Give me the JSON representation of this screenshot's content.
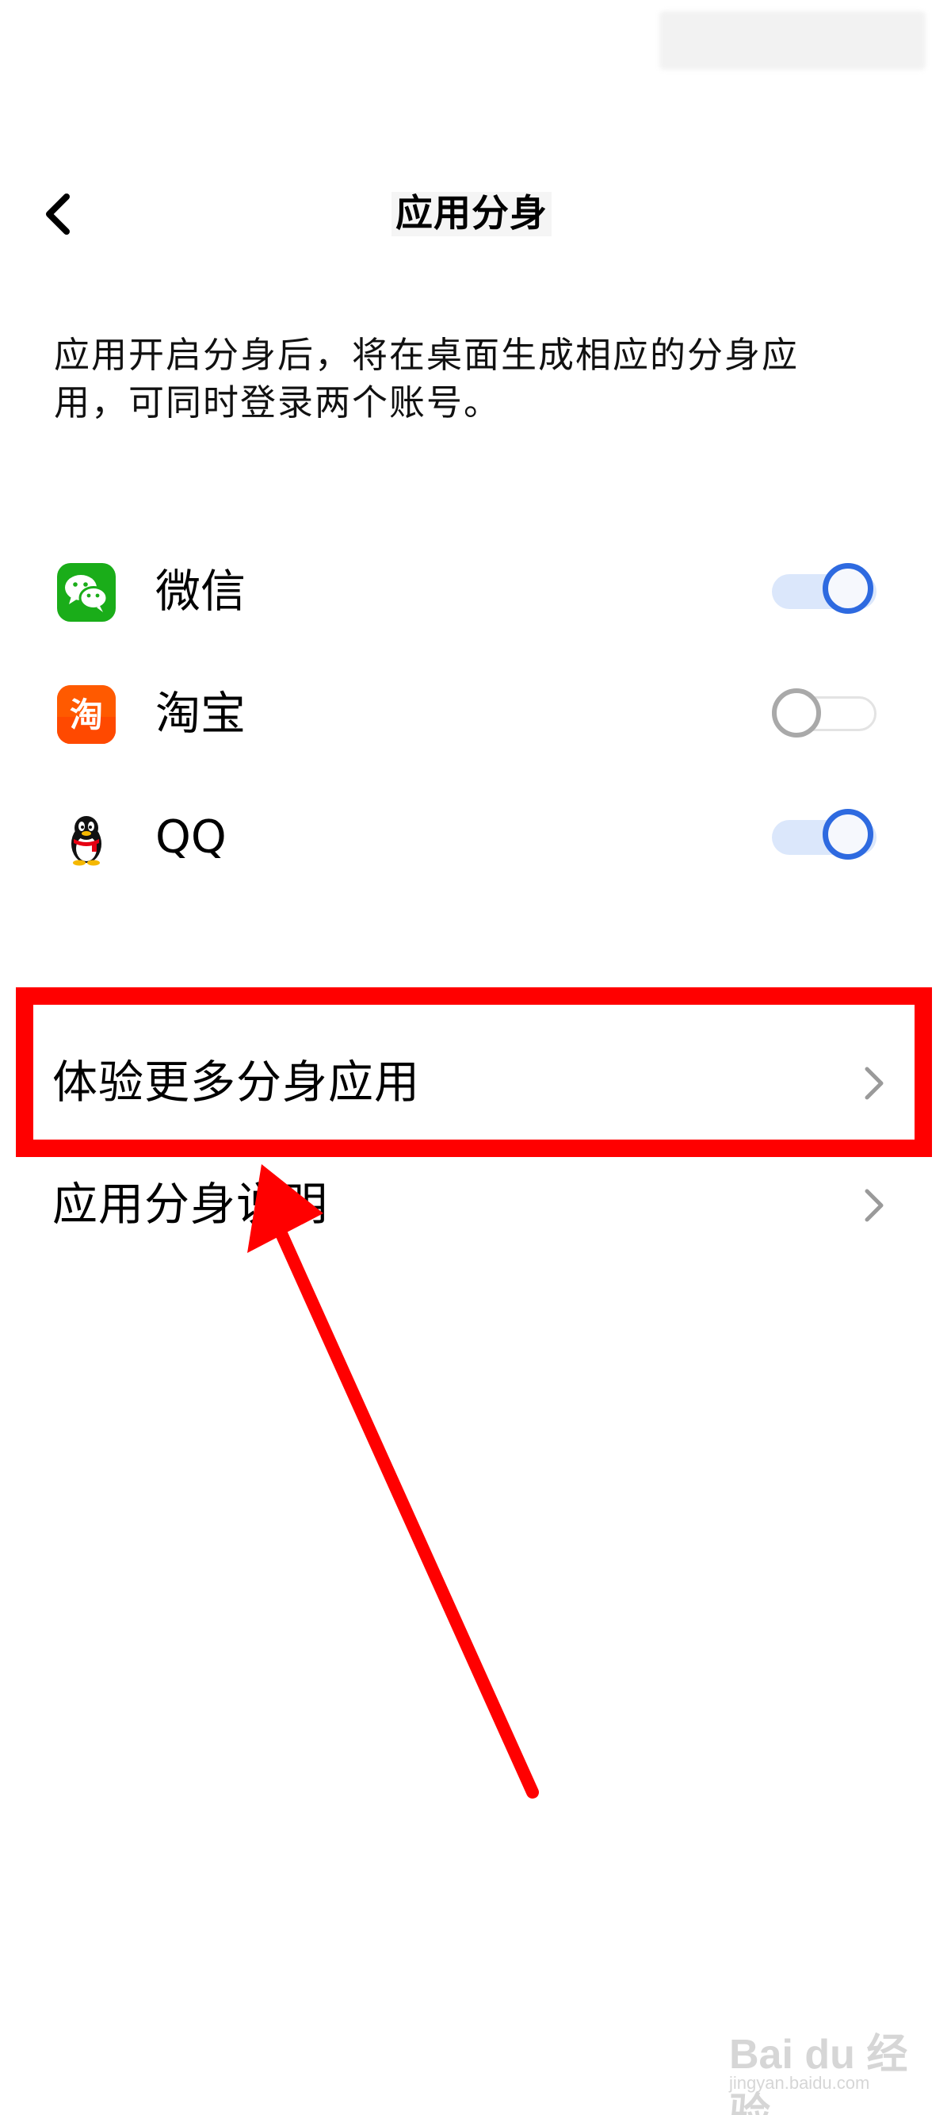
{
  "header": {
    "title": "应用分身",
    "back_icon": "chevron-left-icon"
  },
  "description": "应用开启分身后，将在桌面生成相应的分身应用，可同时登录两个账号。",
  "apps": [
    {
      "name": "微信",
      "icon": "wechat-icon",
      "icon_color": "#1aad19",
      "enabled": true
    },
    {
      "name": "淘宝",
      "icon": "taobao-icon",
      "icon_color": "#ff5000",
      "icon_text": "淘",
      "enabled": false
    },
    {
      "name": "QQ",
      "icon": "qq-penguin-icon",
      "enabled": true
    }
  ],
  "links": [
    {
      "label": "体验更多分身应用",
      "icon": "chevron-right-icon"
    },
    {
      "label": "应用分身说明",
      "icon": "chevron-right-icon"
    }
  ],
  "annotation": {
    "color": "#ff0000",
    "highlighted_item": "体验更多分身应用"
  },
  "watermark": {
    "main": "Bai du 经验",
    "sub": "jingyan.baidu.com"
  },
  "colors": {
    "toggle_on": "#2e6ae0",
    "toggle_on_track": "#dbe7fb",
    "toggle_off": "#a9a9a9",
    "chevron": "#9a9a9a"
  }
}
